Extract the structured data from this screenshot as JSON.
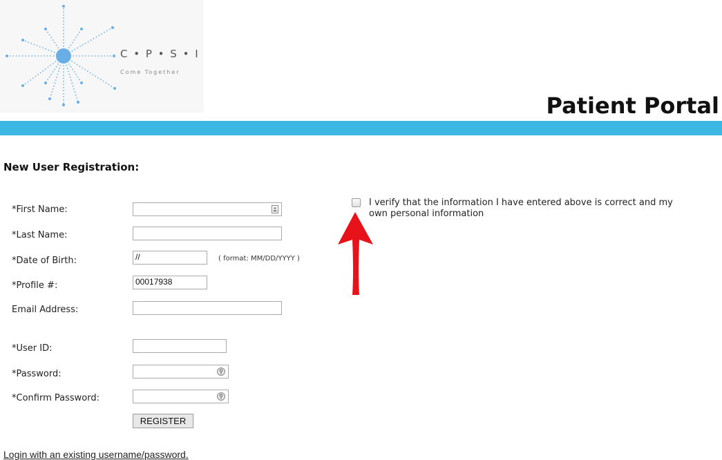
{
  "logo": {
    "name": "C • P • S • I",
    "tagline": "Come Together"
  },
  "header": {
    "title": "Patient Portal"
  },
  "form": {
    "heading": "New User Registration:",
    "first_name_label": "*First Name:",
    "last_name_label": "*Last Name:",
    "dob_label": "*Date of Birth:",
    "dob_value": "//",
    "dob_hint": "( format: MM/DD/YYYY )",
    "profile_label": "*Profile #:",
    "profile_value": "00017938",
    "email_label": "Email Address:",
    "userid_label": "*User ID:",
    "password_label": "*Password:",
    "confirm_label": "*Confirm Password:",
    "register_label": "REGISTER",
    "verify_text": "I verify that the information I have entered above is correct and my own personal information",
    "verify_checked": false
  },
  "footer": {
    "login_link": "Login with an existing username/password."
  },
  "colors": {
    "band": "#3cb6e3",
    "arrow": "#e8121b",
    "logo_dots": "#6aaee8"
  }
}
